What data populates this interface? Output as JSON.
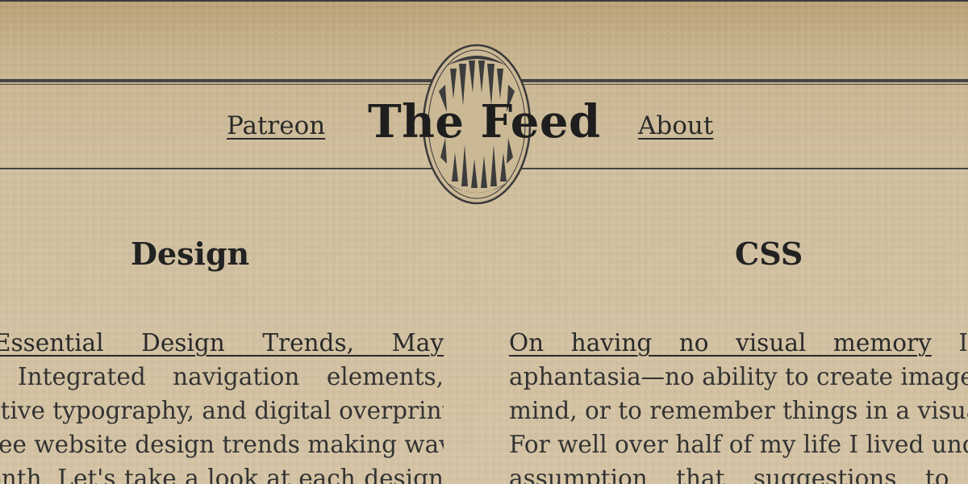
{
  "header": {
    "title": "The Feed",
    "nav": [
      {
        "label": "Patreon"
      },
      {
        "label": "About"
      }
    ]
  },
  "columns": [
    {
      "heading": "Design",
      "article_link": "Essential Design Trends, May",
      "lines": [
        "Integrated navigation elements,",
        "ctive typography, and digital overprints",
        "ree website design trends making waves",
        "onth. Let's take a look at each design"
      ]
    },
    {
      "heading": "CSS",
      "article_link": "On having no visual memory",
      "link_tail": "I",
      "lines": [
        "aphantasia—no ability to create images i",
        "mind, or to remember things in a visual",
        "For well over half of my life I lived unde",
        "assumption that suggestions to visu"
      ]
    }
  ],
  "colors": {
    "background": "#cdbb9a",
    "ink": "#2b2b2b",
    "rule": "#444444"
  }
}
